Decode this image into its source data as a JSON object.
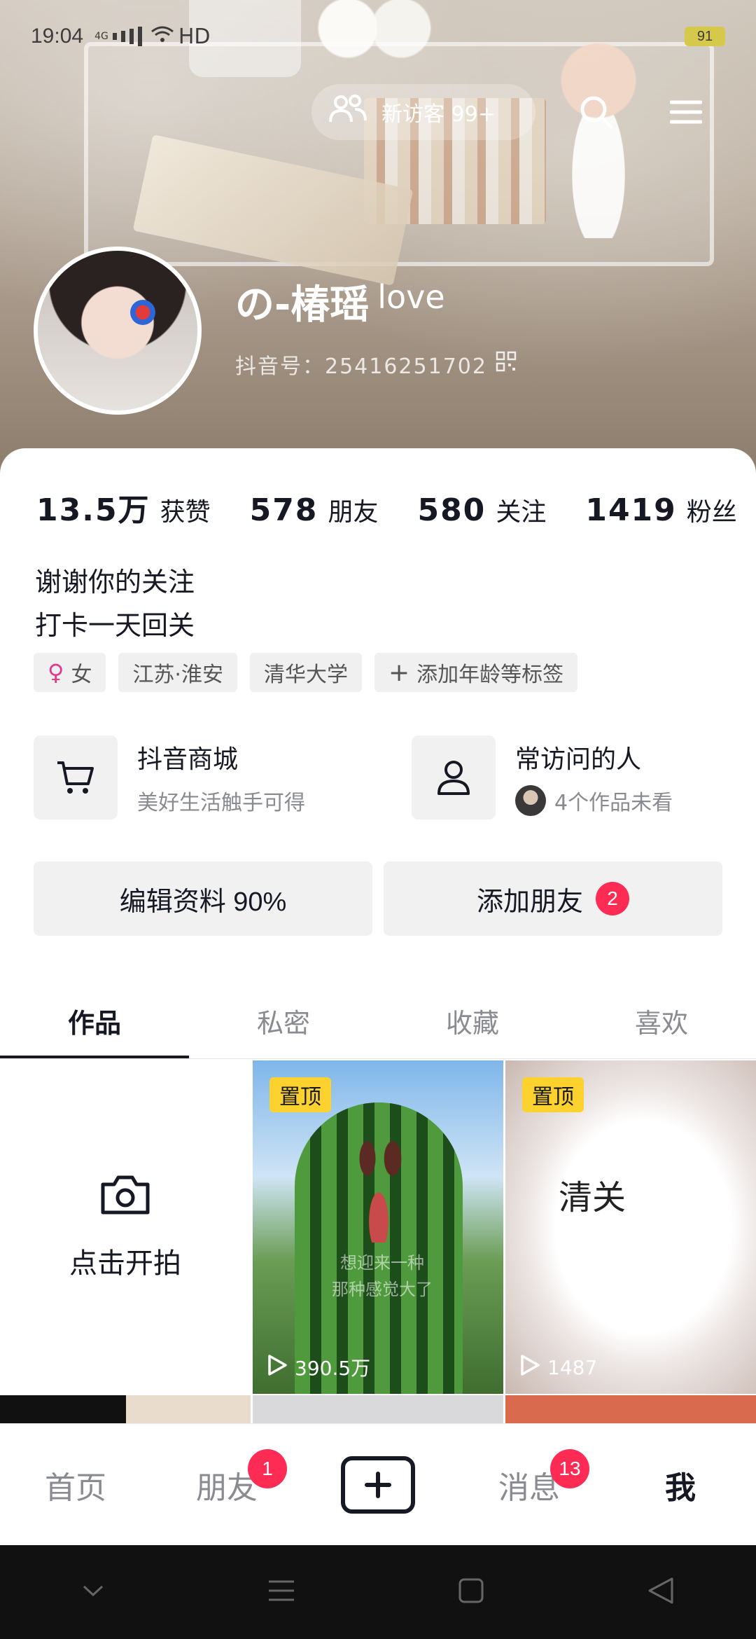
{
  "status_bar": {
    "time": "19:04",
    "network": "4G",
    "hd": "HD",
    "battery": "91"
  },
  "header": {
    "visitor_label": "新访客 99+",
    "username": "の-椿瑶",
    "username_suffix": "love",
    "douyin_id": "抖音号：2541625170​2"
  },
  "stats": [
    {
      "value": "13.5万",
      "label": "获赞"
    },
    {
      "value": "578",
      "label": "朋友"
    },
    {
      "value": "580",
      "label": "关注"
    },
    {
      "value": "1419",
      "label": "粉丝"
    }
  ],
  "bio": {
    "line1": "谢谢你的关注",
    "line2": "打卡一天回关"
  },
  "tags": {
    "gender": "女",
    "location": "江苏·淮安",
    "school": "清华大学",
    "add": "添加年龄等标签"
  },
  "cards": {
    "mall_title": "抖音商城",
    "mall_sub": "美好生活触手可得",
    "visitors_title": "常访问的人",
    "visitors_sub": "4个作品未看"
  },
  "buttons": {
    "edit": "编辑资料 90%",
    "add_friend": "添加朋友",
    "add_friend_badge": "2"
  },
  "tabs": [
    "作品",
    "私密",
    "收藏",
    "喜欢"
  ],
  "grid": {
    "shoot_label": "点击开拍",
    "videos": [
      {
        "pinned": "置顶",
        "plays": "390.5万",
        "overlay": "想迎来一种",
        "overlay2": "那种感觉大了"
      },
      {
        "pinned": "置顶",
        "plays": "1487",
        "title": "清关"
      }
    ]
  },
  "bottom_nav": [
    {
      "label": "首页"
    },
    {
      "label": "朋友",
      "badge": "1"
    },
    {
      "label": ""
    },
    {
      "label": "消息",
      "badge": "13"
    },
    {
      "label": "我"
    }
  ]
}
